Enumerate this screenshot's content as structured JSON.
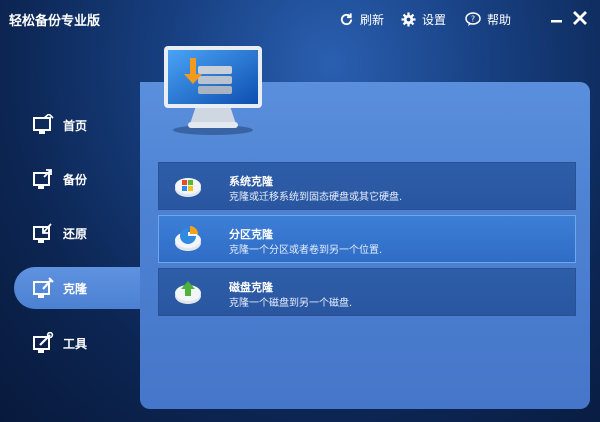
{
  "app": {
    "title": "轻松备份专业版"
  },
  "toolbar": {
    "refresh": "刷新",
    "settings": "设置",
    "help": "帮助"
  },
  "sidebar": {
    "items": [
      {
        "label": "首页",
        "icon": "home-icon"
      },
      {
        "label": "备份",
        "icon": "backup-icon"
      },
      {
        "label": "还原",
        "icon": "restore-icon"
      },
      {
        "label": "克隆",
        "icon": "clone-icon",
        "active": true
      },
      {
        "label": "工具",
        "icon": "tools-icon"
      }
    ]
  },
  "clone": {
    "options": [
      {
        "title": "系统克隆",
        "desc": "克隆或迁移系统到固态硬盘或其它硬盘.",
        "icon": "system-clone-icon"
      },
      {
        "title": "分区克隆",
        "desc": "克隆一个分区或者卷到另一个位置.",
        "icon": "partition-clone-icon",
        "selected": true
      },
      {
        "title": "磁盘克隆",
        "desc": "克隆一个磁盘到另一个磁盘.",
        "icon": "disk-clone-icon"
      }
    ]
  },
  "colors": {
    "accent": "#3f7dd4",
    "background": "#0c2552",
    "panel": "#4d82d3"
  }
}
